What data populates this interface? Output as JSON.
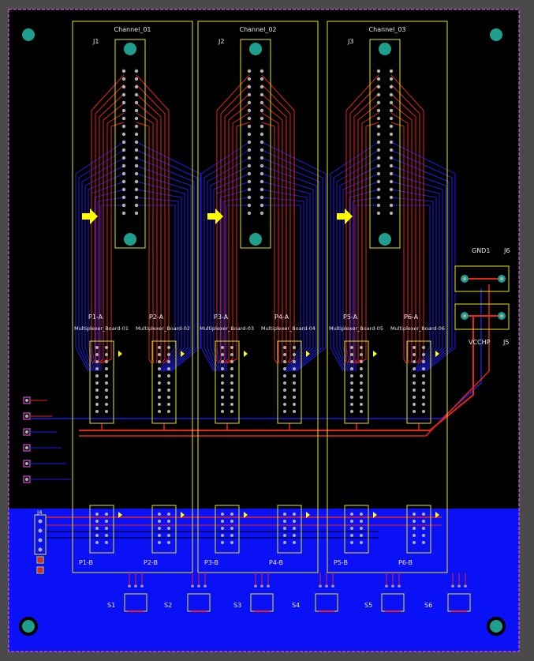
{
  "colors": {
    "board_black": "#000000",
    "bottom_copper": "#0a12f5",
    "top_trace": "#e8231a",
    "blue_trace": "#1c1ce8",
    "silkscreen": "#e6e619",
    "pad": "#1e9e8c",
    "pin": "#b0b0b0",
    "arrow": "#ffff00",
    "outline": "#ff55ff",
    "frame": "#4a4a4a"
  },
  "channels": [
    {
      "title": "Channel_01",
      "connector": "J1",
      "mux_a": "P1-A",
      "mux_b": "P2-A",
      "board_a": "Multiplexer_Board-01",
      "board_b": "Multiplexer_Board-02",
      "low_a": "P1-B",
      "low_b": "P2-B"
    },
    {
      "title": "Channel_02",
      "connector": "J2",
      "mux_a": "P3-A",
      "mux_b": "P4-A",
      "board_a": "Multiplexer_Board-03",
      "board_b": "Multiplexer_Board-04",
      "low_a": "P3-B",
      "low_b": "P4-B"
    },
    {
      "title": "Channel_03",
      "connector": "J3",
      "mux_a": "P5-A",
      "mux_b": "P6-A",
      "board_a": "Multiplexer_Board-05",
      "board_b": "Multiplexer_Board-06",
      "low_a": "P5-B",
      "low_b": "P6-B"
    }
  ],
  "power": {
    "gnd_label": "GND1",
    "gnd_ref": "J6",
    "vcc_label": "VCCHP",
    "vcc_ref": "J5"
  },
  "header": {
    "ref": "J4"
  },
  "switches": [
    "S1",
    "S2",
    "S3",
    "S4",
    "S5",
    "S6"
  ]
}
